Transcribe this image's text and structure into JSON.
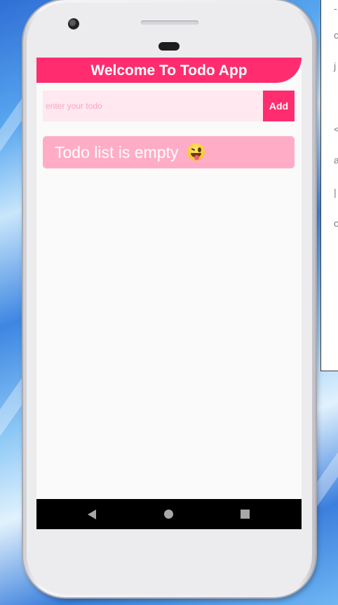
{
  "app": {
    "title": "Welcome To Todo App"
  },
  "input": {
    "placeholder": "enter your todo",
    "value": ""
  },
  "add_button": {
    "label": "Add"
  },
  "empty_state": {
    "message": "Todo list is empty"
  },
  "icons": {
    "empty_emoji": "winking-face-with-tongue-icon",
    "nav_back": "back-triangle-icon",
    "nav_home": "home-circle-icon",
    "nav_recents": "recents-square-icon"
  },
  "colors": {
    "accent": "#ff2d70",
    "card": "#ffadc6",
    "input_bg": "#ffe8ef",
    "screen_bg": "#fafafa",
    "nav_bar": "#000000"
  }
}
